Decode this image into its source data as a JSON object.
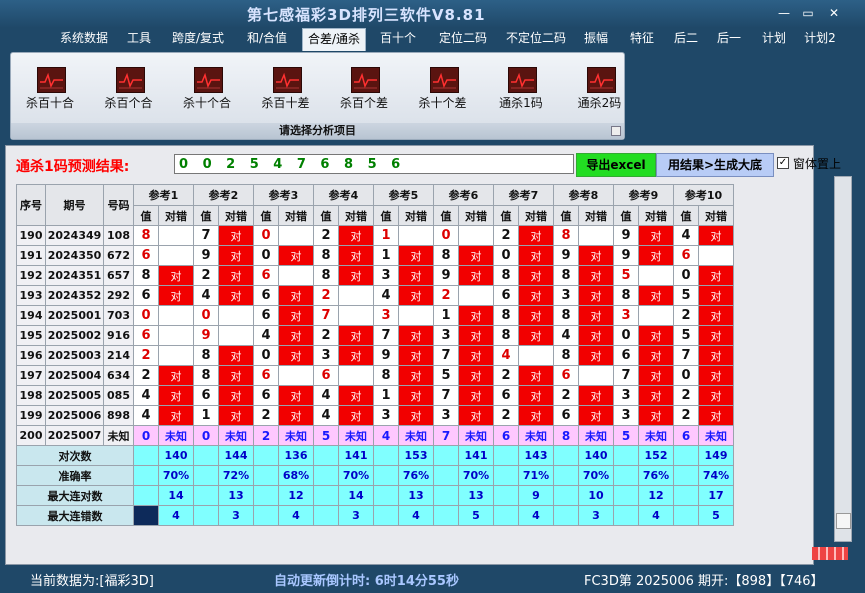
{
  "window": {
    "title": "第七感福彩3D排列三软件V8.81",
    "minimize": "—",
    "restore": "▭",
    "close": "✕"
  },
  "menu": [
    "系统数据",
    "工具",
    "跨度/复式",
    "和/合值",
    "合差/通杀",
    "百十个",
    "定位二码",
    "不定位二码",
    "振幅",
    "特征",
    "后二",
    "后一",
    "计划",
    "计划2"
  ],
  "menu_active": "合差/通杀",
  "ribbon": {
    "tools": [
      "杀百十合",
      "杀百个合",
      "杀十个合",
      "杀百十差",
      "杀百个差",
      "杀十个差",
      "通杀1码",
      "通杀2码"
    ],
    "caption": "请选择分析项目"
  },
  "prediction": {
    "label": "通杀1码预测结果:",
    "value": "0 0 2 5 4 7 6 8 5 6"
  },
  "buttons": {
    "export": "导出excel",
    "generate": "用结果>生成大底",
    "pin_label": "窗体置上",
    "pin_check": "✓"
  },
  "table": {
    "headers": {
      "seq": "序号",
      "period": "期号",
      "num": "号码",
      "value": "值",
      "result": "对错"
    },
    "refs": [
      "参考1",
      "参考2",
      "参考3",
      "参考4",
      "参考5",
      "参考6",
      "参考7",
      "参考8",
      "参考9",
      "参考10"
    ],
    "ok_text": "对",
    "rows": [
      {
        "seq": "190",
        "period": "2024349",
        "num": "108",
        "cells": [
          [
            "8",
            "red",
            ""
          ],
          [
            "7",
            "blk",
            "对"
          ],
          [
            "0",
            "red",
            ""
          ],
          [
            "2",
            "blk",
            "对"
          ],
          [
            "1",
            "red",
            ""
          ],
          [
            "0",
            "red",
            ""
          ],
          [
            "2",
            "blk",
            "对"
          ],
          [
            "8",
            "red",
            ""
          ],
          [
            "9",
            "blk",
            "对"
          ],
          [
            "4",
            "blk",
            "对"
          ]
        ]
      },
      {
        "seq": "191",
        "period": "2024350",
        "num": "672",
        "cells": [
          [
            "6",
            "red",
            ""
          ],
          [
            "9",
            "blk",
            "对"
          ],
          [
            "0",
            "blk",
            "对"
          ],
          [
            "8",
            "blk",
            "对"
          ],
          [
            "1",
            "blk",
            "对"
          ],
          [
            "8",
            "blk",
            "对"
          ],
          [
            "0",
            "blk",
            "对"
          ],
          [
            "9",
            "blk",
            "对"
          ],
          [
            "9",
            "blk",
            "对"
          ],
          [
            "6",
            "red",
            ""
          ]
        ]
      },
      {
        "seq": "192",
        "period": "2024351",
        "num": "657",
        "cells": [
          [
            "8",
            "blk",
            "对"
          ],
          [
            "2",
            "blk",
            "对"
          ],
          [
            "6",
            "red",
            ""
          ],
          [
            "8",
            "blk",
            "对"
          ],
          [
            "3",
            "blk",
            "对"
          ],
          [
            "9",
            "blk",
            "对"
          ],
          [
            "8",
            "blk",
            "对"
          ],
          [
            "8",
            "blk",
            "对"
          ],
          [
            "5",
            "red",
            ""
          ],
          [
            "0",
            "blk",
            "对"
          ]
        ]
      },
      {
        "seq": "193",
        "period": "2024352",
        "num": "292",
        "cells": [
          [
            "6",
            "blk",
            "对"
          ],
          [
            "4",
            "blk",
            "对"
          ],
          [
            "6",
            "blk",
            "对"
          ],
          [
            "2",
            "red",
            ""
          ],
          [
            "4",
            "blk",
            "对"
          ],
          [
            "2",
            "red",
            ""
          ],
          [
            "6",
            "blk",
            "对"
          ],
          [
            "3",
            "blk",
            "对"
          ],
          [
            "8",
            "blk",
            "对"
          ],
          [
            "5",
            "blk",
            "对"
          ]
        ]
      },
      {
        "seq": "194",
        "period": "2025001",
        "num": "703",
        "cells": [
          [
            "0",
            "red",
            ""
          ],
          [
            "0",
            "red",
            ""
          ],
          [
            "6",
            "blk",
            "对"
          ],
          [
            "7",
            "red",
            ""
          ],
          [
            "3",
            "red",
            ""
          ],
          [
            "1",
            "blk",
            "对"
          ],
          [
            "8",
            "blk",
            "对"
          ],
          [
            "8",
            "blk",
            "对"
          ],
          [
            "3",
            "red",
            ""
          ],
          [
            "2",
            "blk",
            "对"
          ]
        ]
      },
      {
        "seq": "195",
        "period": "2025002",
        "num": "916",
        "cells": [
          [
            "6",
            "red",
            ""
          ],
          [
            "9",
            "red",
            ""
          ],
          [
            "4",
            "blk",
            "对"
          ],
          [
            "2",
            "blk",
            "对"
          ],
          [
            "7",
            "blk",
            "对"
          ],
          [
            "3",
            "blk",
            "对"
          ],
          [
            "8",
            "blk",
            "对"
          ],
          [
            "4",
            "blk",
            "对"
          ],
          [
            "0",
            "blk",
            "对"
          ],
          [
            "5",
            "blk",
            "对"
          ]
        ]
      },
      {
        "seq": "196",
        "period": "2025003",
        "num": "214",
        "cells": [
          [
            "2",
            "red",
            ""
          ],
          [
            "8",
            "blk",
            "对"
          ],
          [
            "0",
            "blk",
            "对"
          ],
          [
            "3",
            "blk",
            "对"
          ],
          [
            "9",
            "blk",
            "对"
          ],
          [
            "7",
            "blk",
            "对"
          ],
          [
            "4",
            "red",
            ""
          ],
          [
            "8",
            "blk",
            "对"
          ],
          [
            "6",
            "blk",
            "对"
          ],
          [
            "7",
            "blk",
            "对"
          ]
        ]
      },
      {
        "seq": "197",
        "period": "2025004",
        "num": "634",
        "cells": [
          [
            "2",
            "blk",
            "对"
          ],
          [
            "8",
            "blk",
            "对"
          ],
          [
            "6",
            "red",
            ""
          ],
          [
            "6",
            "red",
            ""
          ],
          [
            "8",
            "blk",
            "对"
          ],
          [
            "5",
            "blk",
            "对"
          ],
          [
            "2",
            "blk",
            "对"
          ],
          [
            "6",
            "red",
            ""
          ],
          [
            "7",
            "blk",
            "对"
          ],
          [
            "0",
            "blk",
            "对"
          ]
        ]
      },
      {
        "seq": "198",
        "period": "2025005",
        "num": "085",
        "cells": [
          [
            "4",
            "blk",
            "对"
          ],
          [
            "6",
            "blk",
            "对"
          ],
          [
            "6",
            "blk",
            "对"
          ],
          [
            "4",
            "blk",
            "对"
          ],
          [
            "1",
            "blk",
            "对"
          ],
          [
            "7",
            "blk",
            "对"
          ],
          [
            "6",
            "blk",
            "对"
          ],
          [
            "2",
            "blk",
            "对"
          ],
          [
            "3",
            "blk",
            "对"
          ],
          [
            "2",
            "blk",
            "对"
          ]
        ]
      },
      {
        "seq": "199",
        "period": "2025006",
        "num": "898",
        "cells": [
          [
            "4",
            "blk",
            "对"
          ],
          [
            "1",
            "blk",
            "对"
          ],
          [
            "2",
            "blk",
            "对"
          ],
          [
            "4",
            "blk",
            "对"
          ],
          [
            "3",
            "blk",
            "对"
          ],
          [
            "3",
            "blk",
            "对"
          ],
          [
            "2",
            "blk",
            "对"
          ],
          [
            "6",
            "blk",
            "对"
          ],
          [
            "3",
            "blk",
            "对"
          ],
          [
            "2",
            "blk",
            "对"
          ]
        ]
      }
    ],
    "pending": {
      "seq": "200",
      "period": "2025007",
      "num": "未知",
      "unknown": "未知",
      "values": [
        "0",
        "0",
        "2",
        "5",
        "4",
        "7",
        "6",
        "8",
        "5",
        "6"
      ]
    },
    "stats": [
      {
        "label": "对次数",
        "values": [
          "140",
          "144",
          "136",
          "141",
          "153",
          "141",
          "143",
          "140",
          "152",
          "149"
        ]
      },
      {
        "label": "准确率",
        "values": [
          "70%",
          "72%",
          "68%",
          "70%",
          "76%",
          "70%",
          "71%",
          "70%",
          "76%",
          "74%"
        ]
      },
      {
        "label": "最大连对数",
        "values": [
          "14",
          "13",
          "12",
          "14",
          "13",
          "13",
          "9",
          "10",
          "12",
          "17"
        ]
      },
      {
        "label": "最大连错数",
        "values": [
          "4",
          "3",
          "4",
          "3",
          "4",
          "5",
          "4",
          "3",
          "4",
          "5"
        ]
      }
    ]
  },
  "status": {
    "left": "当前数据为:[福彩3D]",
    "mid": "自动更新倒计时: 6时14分55秒",
    "right": "FC3D第 2025006 期开:【898】【746】"
  },
  "colors": {
    "hit": "#f20000",
    "pending": "#ffc8ff",
    "stats": "#80ffff",
    "background": "#1f4868"
  }
}
